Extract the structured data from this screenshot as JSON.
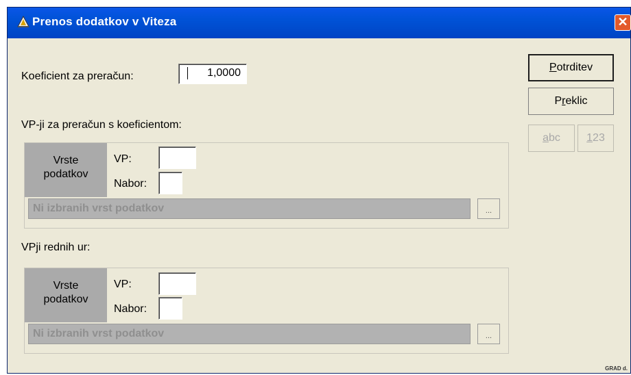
{
  "window": {
    "title": "Prenos dodatkov v Viteza",
    "close_glyph": "✕",
    "corner_label": "GRAD d."
  },
  "coefficient": {
    "label": "Koeficient za preračun:",
    "value": "1,0000"
  },
  "section1": {
    "heading": "VP-ji za preračun s koeficientom:",
    "types_label_line1": "Vrste",
    "types_label_line2": "podatkov",
    "vp_label": "VP:",
    "vp_value": "",
    "nabor_label": "Nabor:",
    "nabor_value": "",
    "selection_text": "Ni izbranih vrst podatkov",
    "browse_label": "..."
  },
  "section2": {
    "heading": "VPji rednih ur:",
    "types_label_line1": "Vrste",
    "types_label_line2": "podatkov",
    "vp_label": "VP:",
    "vp_value": "",
    "nabor_label": "Nabor:",
    "nabor_value": "",
    "selection_text": "Ni izbranih vrst podatkov",
    "browse_label": "..."
  },
  "buttons": {
    "confirm_prefix": "",
    "confirm_hotkey": "P",
    "confirm_rest": "otrditev",
    "cancel_prefix": "P",
    "cancel_hotkey": "r",
    "cancel_rest": "eklic",
    "abc_hotkey": "a",
    "abc_rest": "bc",
    "num_hotkey": "1",
    "num_rest": "23"
  }
}
